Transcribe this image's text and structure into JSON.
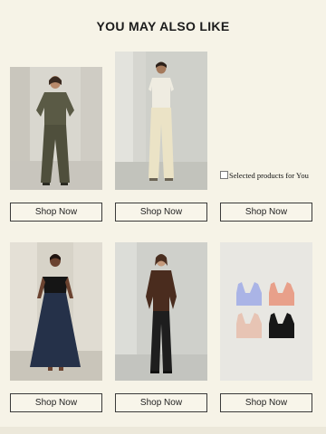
{
  "section": {
    "title": "YOU MAY ALSO LIKE"
  },
  "products": [
    {
      "image_alt": "Model in olive oversized top and wide trousers",
      "button": "Shop Now"
    },
    {
      "image_alt": "Model in cream knit tee and cream wide trousers",
      "button": "Shop Now"
    },
    {
      "image_alt": "Selected products for You",
      "button": "Shop Now"
    },
    {
      "image_alt": "Model in black off-shoulder top and navy full skirt",
      "button": "Shop Now"
    },
    {
      "image_alt": "Model in brown leather jacket and black trousers",
      "button": "Shop Now"
    },
    {
      "image_alt": "Four bralettes in lavender, coral, beige and black",
      "button": "Shop Now"
    }
  ]
}
